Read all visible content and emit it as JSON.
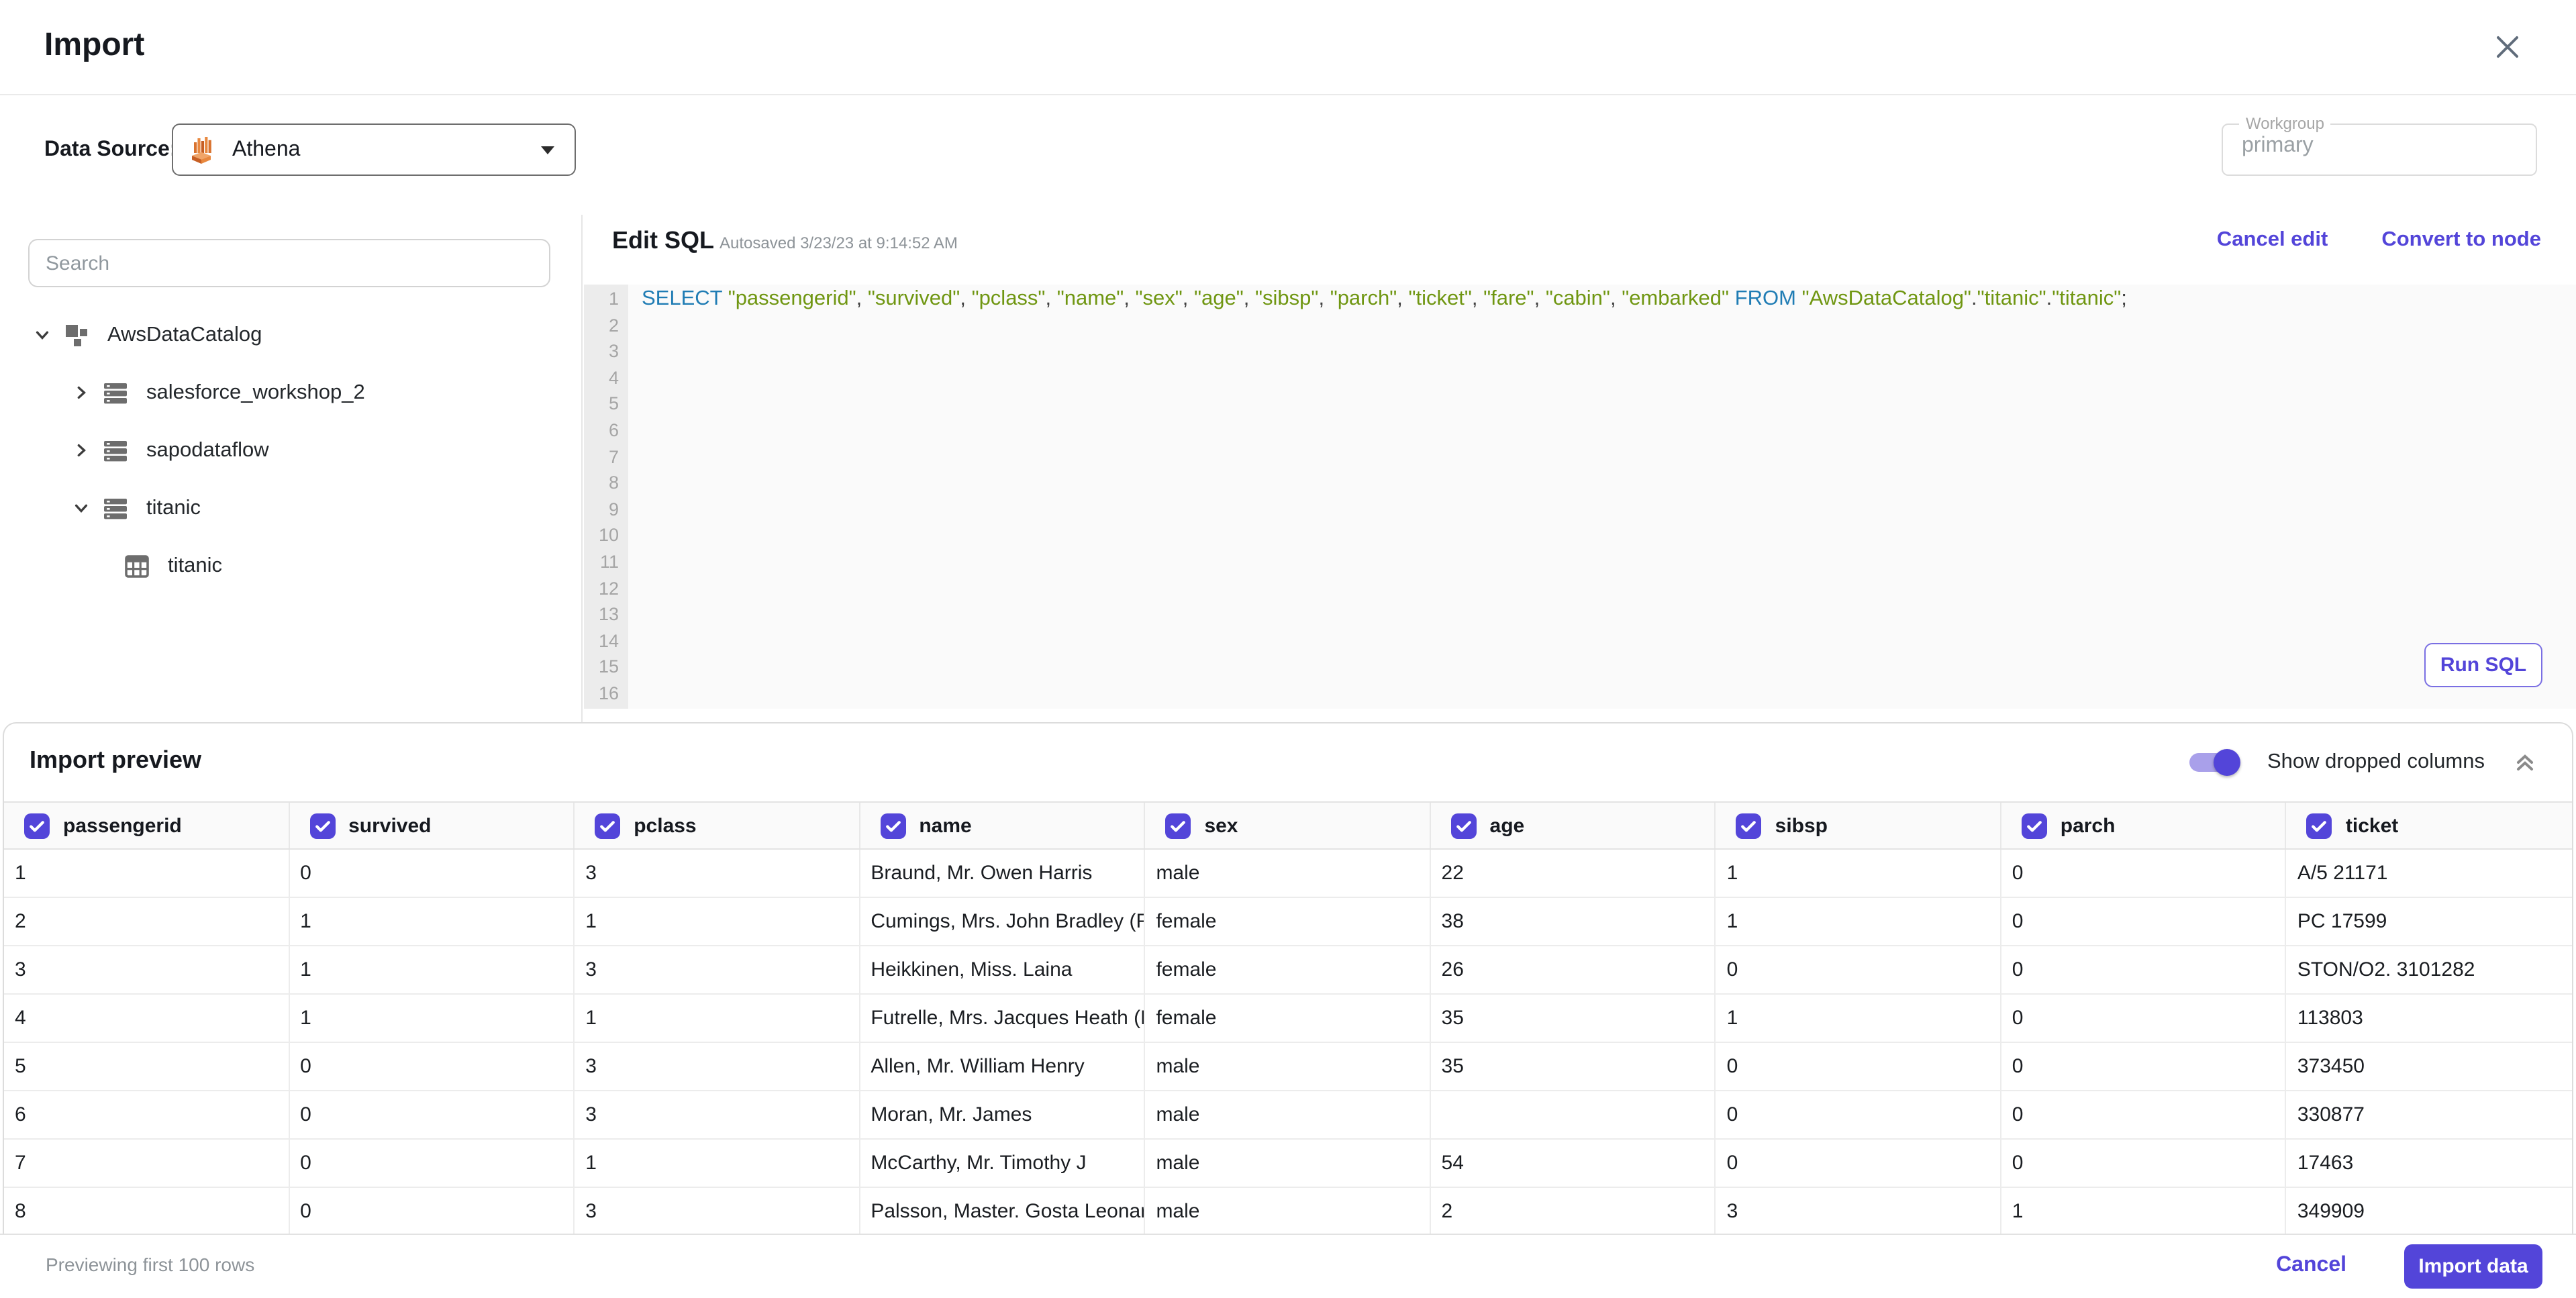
{
  "header": {
    "title": "Import"
  },
  "datasource": {
    "label": "Data Source:",
    "selected": "Athena"
  },
  "workgroup": {
    "label": "Workgroup",
    "value": "primary"
  },
  "sidebar": {
    "search_placeholder": "Search",
    "tree": [
      {
        "label": "AwsDataCatalog",
        "level": 1,
        "icon": "catalog",
        "chevron": "down"
      },
      {
        "label": "salesforce_workshop_2",
        "level": 2,
        "icon": "database",
        "chevron": "right"
      },
      {
        "label": "sapodataflow",
        "level": 2,
        "icon": "database",
        "chevron": "right"
      },
      {
        "label": "titanic",
        "level": 2,
        "icon": "database",
        "chevron": "down"
      },
      {
        "label": "titanic",
        "level": 3,
        "icon": "table",
        "chevron": "none"
      }
    ]
  },
  "editor": {
    "title": "Edit SQL",
    "autosave": "Autosaved 3/23/23 at 9:14:52 AM",
    "cancel_edit": "Cancel edit",
    "convert_to_node": "Convert to node",
    "run_sql": "Run SQL",
    "line_count": 16,
    "sql_tokens": [
      {
        "c": "kw",
        "t": "SELECT"
      },
      {
        "c": "pl",
        "t": " "
      },
      {
        "c": "str",
        "t": "\"passengerid\""
      },
      {
        "c": "pl",
        "t": ", "
      },
      {
        "c": "str",
        "t": "\"survived\""
      },
      {
        "c": "pl",
        "t": ", "
      },
      {
        "c": "str",
        "t": "\"pclass\""
      },
      {
        "c": "pl",
        "t": ", "
      },
      {
        "c": "str",
        "t": "\"name\""
      },
      {
        "c": "pl",
        "t": ", "
      },
      {
        "c": "str",
        "t": "\"sex\""
      },
      {
        "c": "pl",
        "t": ", "
      },
      {
        "c": "str",
        "t": "\"age\""
      },
      {
        "c": "pl",
        "t": ", "
      },
      {
        "c": "str",
        "t": "\"sibsp\""
      },
      {
        "c": "pl",
        "t": ", "
      },
      {
        "c": "str",
        "t": "\"parch\""
      },
      {
        "c": "pl",
        "t": ", "
      },
      {
        "c": "str",
        "t": "\"ticket\""
      },
      {
        "c": "pl",
        "t": ", "
      },
      {
        "c": "str",
        "t": "\"fare\""
      },
      {
        "c": "pl",
        "t": ", "
      },
      {
        "c": "str",
        "t": "\"cabin\""
      },
      {
        "c": "pl",
        "t": ", "
      },
      {
        "c": "str",
        "t": "\"embarked\""
      },
      {
        "c": "pl",
        "t": " "
      },
      {
        "c": "kw",
        "t": "FROM"
      },
      {
        "c": "pl",
        "t": " "
      },
      {
        "c": "str",
        "t": "\"AwsDataCatalog\""
      },
      {
        "c": "pl",
        "t": "."
      },
      {
        "c": "str",
        "t": "\"titanic\""
      },
      {
        "c": "pl",
        "t": "."
      },
      {
        "c": "str",
        "t": "\"titanic\""
      },
      {
        "c": "pl",
        "t": ";"
      }
    ]
  },
  "preview": {
    "title": "Import preview",
    "toggle_label": "Show dropped columns",
    "toggle_on": true,
    "columns": [
      "passengerid",
      "survived",
      "pclass",
      "name",
      "sex",
      "age",
      "sibsp",
      "parch",
      "ticket"
    ],
    "rows": [
      [
        "1",
        "0",
        "3",
        "Braund, Mr. Owen Harris",
        "male",
        "22",
        "1",
        "0",
        "A/5 21171"
      ],
      [
        "2",
        "1",
        "1",
        "Cumings, Mrs. John Bradley (Florenc",
        "female",
        "38",
        "1",
        "0",
        "PC 17599"
      ],
      [
        "3",
        "1",
        "3",
        "Heikkinen, Miss. Laina",
        "female",
        "26",
        "0",
        "0",
        "STON/O2. 3101282"
      ],
      [
        "4",
        "1",
        "1",
        "Futrelle, Mrs. Jacques Heath (Lily Ma",
        "female",
        "35",
        "1",
        "0",
        "113803"
      ],
      [
        "5",
        "0",
        "3",
        "Allen, Mr. William Henry",
        "male",
        "35",
        "0",
        "0",
        "373450"
      ],
      [
        "6",
        "0",
        "3",
        "Moran, Mr. James",
        "male",
        "",
        "0",
        "0",
        "330877"
      ],
      [
        "7",
        "0",
        "1",
        "McCarthy, Mr. Timothy J",
        "male",
        "54",
        "0",
        "0",
        "17463"
      ],
      [
        "8",
        "0",
        "3",
        "Palsson, Master. Gosta Leonard",
        "male",
        "2",
        "3",
        "1",
        "349909"
      ]
    ]
  },
  "footer": {
    "status": "Previewing first 100 rows",
    "cancel": "Cancel",
    "import": "Import data"
  },
  "colors": {
    "primary": "#5345d9",
    "toggle_track": "#a9a0ea",
    "sql_keyword": "#1f7cb4",
    "sql_string": "#6f9611",
    "athena_orange": "#e07b39"
  }
}
